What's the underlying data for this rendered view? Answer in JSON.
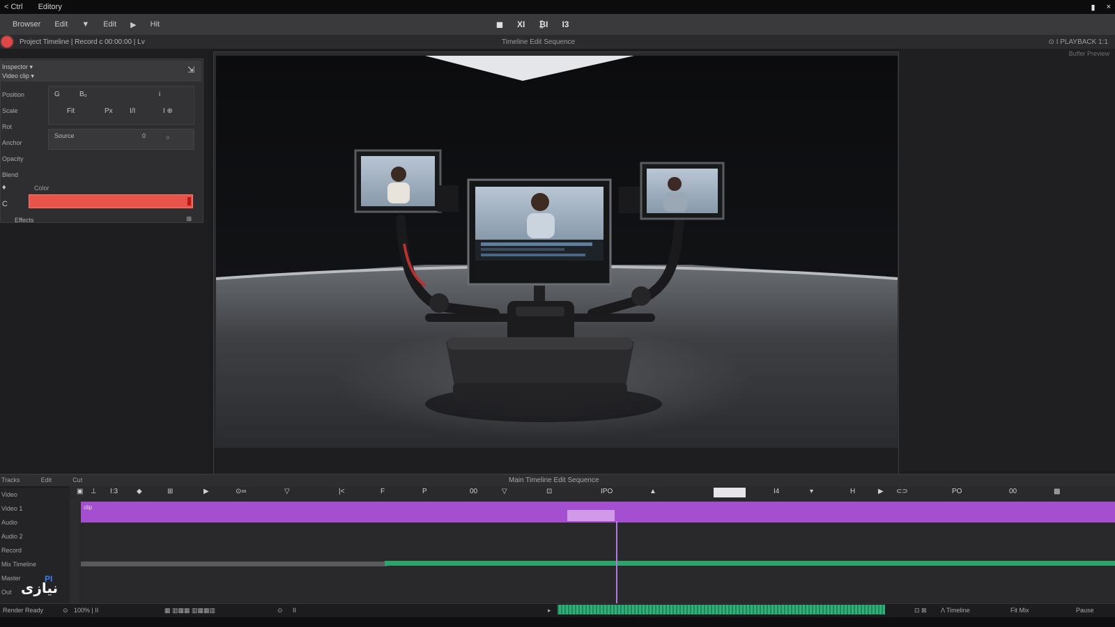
{
  "titlebar": {
    "app": "< Ctrl",
    "title": "Editory",
    "ctrl_min": "▮",
    "ctrl_close": "×"
  },
  "menu": {
    "items": [
      "Browser",
      "Edit",
      "▼",
      "Edit",
      "▶",
      "Hit"
    ]
  },
  "transport": {
    "b1": "◼",
    "b2": "XI",
    "b3": "₿I",
    "b4": "I3"
  },
  "infobar": {
    "left_text": "Project  Timeline  |  Record  c  00:00:00  |  Lv",
    "center_caption": "Timeline Edit Sequence",
    "right_text": "⊙  I  PLAYBACK 1:1"
  },
  "right_caption": "Buffer  Preview",
  "inspector": {
    "head_l1": "Inspector  ▾",
    "head_l2": "Video  clip  ▾",
    "pin_icon": "⇲",
    "labels": [
      "Position",
      "Scale",
      "Rot",
      "Anchor",
      "Opacity",
      "Blend"
    ],
    "box_a": "G",
    "box_b": "B₀",
    "box_c": "i",
    "box_d": "Fit",
    "box_e": "Px",
    "box_f": "I/I",
    "box_g": "I ⊕",
    "box2_a": "Source",
    "box2_b": "0",
    "box2_c": "○",
    "color_label": "Color",
    "tool_a": "♦",
    "tool_b": "C",
    "foot": "Effects",
    "foot_icon": "⊞"
  },
  "timeline": {
    "hdr_a": "Tracks",
    "hdr_b": "Edit",
    "hdr_c": "Cut",
    "title": "Main Timeline Edit Sequence",
    "ruler": [
      "▣",
      "⊥",
      "I:3",
      "◆",
      "⊞",
      "▶",
      "⊙∞",
      "▽",
      "|<",
      "F",
      "P",
      "00",
      "▽",
      "⊡",
      "IPO",
      "▲",
      "I4",
      "▾",
      "H",
      "▶",
      "⊂⊃",
      "PO",
      "00",
      "▩"
    ],
    "tracks": [
      "Video",
      "Video 1",
      "Audio",
      "Audio 2",
      "Record",
      "Mix Timeline",
      "Master",
      "Out"
    ],
    "clip_name": "clip"
  },
  "statusbar": {
    "a": "Render Ready",
    "b": "⊙",
    "c": "100%  |  II",
    "d": "▦ ▥▦▦ ▥▦▦▥",
    "e": "⊙",
    "f": "II",
    "g": "▸",
    "h": "⊡ ⊠",
    "i": "Λ  Timeline",
    "j": "Fit  Mix",
    "k": "Pause"
  },
  "watermark": {
    "fa": "نیازی",
    "en": "PI"
  }
}
